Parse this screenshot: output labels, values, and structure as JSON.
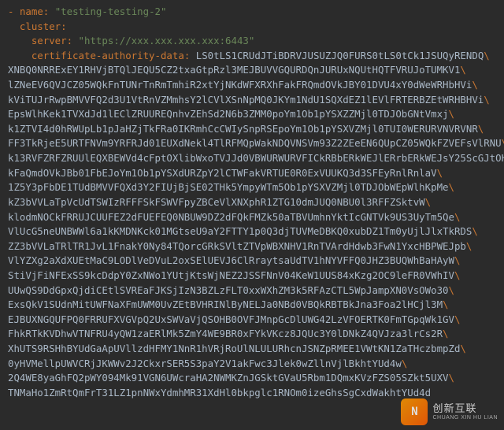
{
  "yaml": {
    "dash": "-",
    "name_key": "name",
    "name_value": "\"testing-testing-2\"",
    "cluster_key": "cluster",
    "server_key": "server",
    "server_value": "\"https://xxx.xxx.xxx.xxx:6443\"",
    "cad_key": "certificate-authority-data",
    "cad_lines": [
      "LS0tLS1CRUdJTiBDRVJUSUZJQ0FURS0tLS0tCk1JSUQyRENDQ",
      "XNBQ0NRRExEY1RHVjBTQlJEQU5CZ2txaGtpRzl3MEJBUVVGQURDQnJURUxNQUtHQTFVRUJoTUMKV1",
      "lZNeEV6QVJCZ05WQkFnTUNrTnRmTmhiR2xtYjNKdWFXRXhFakFRQmdOVkJBY01DVU4xY0dWeWRHbHVi",
      "kViTUJrRwpBMVVFQ2d3U1VtRnVZMmhsY2lCVlXSnNpMQ0JKYm1NdU1SQXdEZ1lEVlFRTERBZEtWRHBHVi",
      "EpsWlhKek1TVXdJd1lEClZRUUREQnhvZEhSd2N6b3ZMM0poYm1Ob1pYSXZZMjl0TDJObGNtVmxj",
      "k1ZTVI4d0hRWUpLb1pJaHZjTkFRa0IKRmhCcCWIySnpRSEpoYm1Ob1pYSXVZMjl0TUI0WERURVNVRVNR",
      "FF3TkRjeE5URTFNVm9YRFRJd01EUXdNekl4TlRFMQpWakNDQVNSVm93Z2ZEeEN6QUpCZ05WQkFZVEFsVlRNU",
      "k13RVFZRFZRUUlEQXBEWVd4cFptOXlibWxoTVJJd0VBWURWURVFICkRBbERkWEJlERrbERkWEJsY25ScGJtOHhH",
      "kFaQmdOVkJBb01FbEJoYm1Ob1pYSXdURZpY2lCTWFakVRTUE0R0ExVUUKQ3d3SFEyRnlRnlaV",
      "1Z5Y3pFbDE1TUdBMVVFQXd3Y2FIUjBjSE02THk5YmpyWTm5Ob1pYSXVZMjl0TDJObWEpWlhKpMe",
      "kZ3bVVLaTpVcUdTSWIzRFFFSkFSWVFpyZBCeVlXNXphR1ZTG10dmJUQ0NBU0l3RFFZSktvW",
      "klodmNOCkFRRUJCUUFEZ2dFUEFEQ0NBUW9DZ2dFQkFMZk50aTBVUmhnYktIcGNTVk9US3UyTm5Qe",
      "VlUcG5neUNBWWl6a1kKMDNKck01MGtseU9aY2FTTY1p0Q3djTUVMeDBKQ0xubDZ1Tm0yUjlJlxTkRDS",
      "ZZ3bVVLaTRlTR1JvL1FnakY0Ny84TQorcGRkSVltZTVpWBXNHV1RnTVArdHdwb3FwN1YxcHBPWEJpb",
      "VlYZXg2aXdXUEtMaC9LODlVeDVuL2oxSElUEVJ6ClRraytsaUdTV1hNYVFFQ0JHZ3BUQWhBaHAyW",
      "StiVjFiNFExSS9kcDdpY0ZxNWo1YUtjKtsWjNEZ2JSSFNnV04KeW1UUS84xKzg2OC9leFR0VWhIV",
      "UUwQS9DdGpxQjdiCEtlSVREaFJKSjIzN3BZLzFLT0xxWXhZM3k5RFAzCTL5WpJampXN0VsOWo30",
      "ExsQkV1SUdnMitUWFNaXFmUWM0UvZEtBVHRINlByNELJa0NBd0VBQkRBTBkJna3Foa2lHCjl3M",
      "EJBUXNGQUFPQ0FRRUFXVGVpQ2UxSWVaVjQSOHB0OVFJMnpGcDlUWG42LzVFOERTK0FmTGpqWk1GV",
      "FhkRTkKVDhwVTNFRU4yQW1zaERlMk5ZmY4WE9BR0xFYkVKcz8JQUc3Y0lDNkZ4QVJza3lrCs2R",
      "XhUTS9RSHhBYUdGaApUVllzdHFMY1NnR1hVRjRoUlNLULURhcnJSNZpRMEE1VWtKN1ZaTHczbmpZd",
      "0yHVMellpUWVCRjJKWWv2J2CkxrSER5S3paY2V1akFwc3Jlek0wZllnVjlBkhtYUd4w",
      "2Q4WE8yaGhFQ2pWY094Mk91VGN6UWcraHA2NWMKZnJGSktGVaU5Rbm1DQmxKVzFZS05SZkt5UXV",
      "TNMaHo1ZmRtQmFrT31LZ1pnNWxYdmhMR31XdHl0bkpglc1RNOm0izeGhsSgCxdWakhtYUd4d"
    ]
  },
  "watermark": {
    "logo_text": "N",
    "cn": "创新互联",
    "en": "CHUANG XIN HU LIAN"
  }
}
